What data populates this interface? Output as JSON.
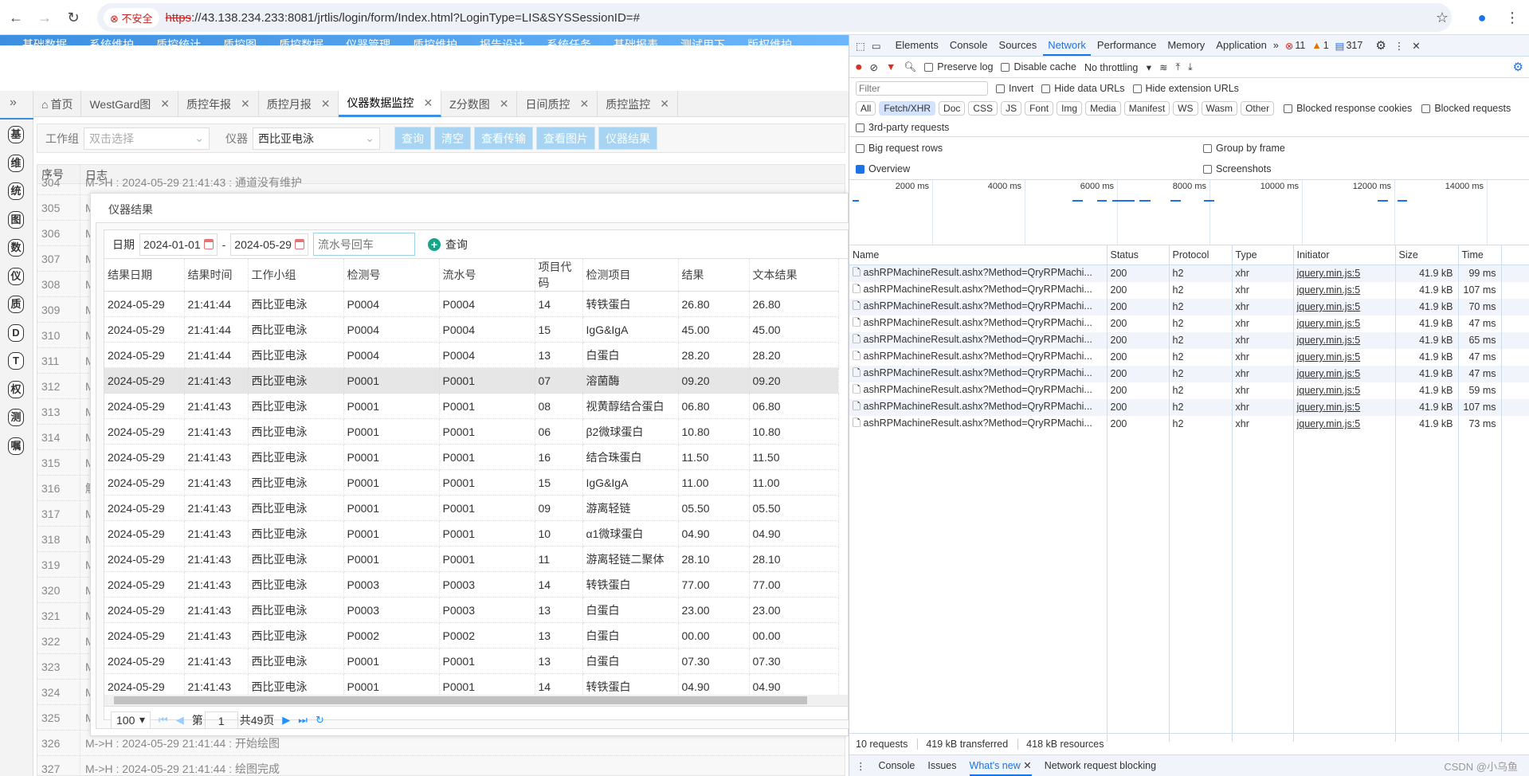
{
  "browser": {
    "url_scheme": "https",
    "url_rest": "://43.138.234.233:8081/jrtlis/login/form/Index.html?LoginType=LIS&SYSSessionID=#",
    "insecure_label": "不安全"
  },
  "topnav": [
    "基础数据",
    "系统维护",
    "质控统计",
    "质控图",
    "质控数据",
    "仪器管理",
    "质控维护",
    "报告设计",
    "系统任务",
    "基础报表",
    "测试用下",
    "版权维护"
  ],
  "sidebar": [
    "基",
    "维",
    "统",
    "图",
    "数",
    "仪",
    "质",
    "D",
    "T",
    "权",
    "测",
    "嘱"
  ],
  "tabs": [
    {
      "label": "首页",
      "icon": "home-icon"
    },
    {
      "label": "WestGard图"
    },
    {
      "label": "质控年报"
    },
    {
      "label": "质控月报"
    },
    {
      "label": "仪器数据监控",
      "active": true
    },
    {
      "label": "Z分数图"
    },
    {
      "label": "日间质控"
    },
    {
      "label": "质控监控"
    }
  ],
  "toolbar": {
    "workgroup_label": "工作组",
    "workgroup_value": "双击选择",
    "instrument_label": "仪器",
    "instrument_value": "西比亚电泳",
    "buttons": [
      "查询",
      "清空",
      "查看传输",
      "查看图片",
      "仪器结果"
    ]
  },
  "log": {
    "columns": [
      "序号",
      "日志"
    ],
    "rows": [
      [
        "304",
        "M->H : 2024-05-29 21:41:43 : 通道没有维护"
      ],
      [
        "305",
        "M"
      ],
      [
        "306",
        "M"
      ],
      [
        "307",
        "M"
      ],
      [
        "308",
        "M"
      ],
      [
        "309",
        "M"
      ],
      [
        "310",
        "M"
      ],
      [
        "311",
        "M"
      ],
      [
        "312",
        "M"
      ],
      [
        "313",
        "M"
      ],
      [
        "314",
        "M"
      ],
      [
        "315",
        "M"
      ],
      [
        "316",
        "解"
      ],
      [
        "317",
        "M"
      ],
      [
        "318",
        "M"
      ],
      [
        "319",
        "M"
      ],
      [
        "320",
        "M"
      ],
      [
        "321",
        "M"
      ],
      [
        "322",
        "M"
      ],
      [
        "323",
        "M"
      ],
      [
        "324",
        "M"
      ],
      [
        "325",
        "M"
      ],
      [
        "326",
        "M->H : 2024-05-29 21:41:44 : 开始绘图"
      ],
      [
        "327",
        "M->H : 2024-05-29 21:41:44 : 绘图完成"
      ]
    ]
  },
  "dialog": {
    "title": "仪器结果",
    "date_label": "日期",
    "date_from": "2024-01-01",
    "date_to": "2024-05-29",
    "serial_placeholder": "流水号回车",
    "query_label": "查询",
    "columns": [
      "结果日期",
      "结果时间",
      "工作小组",
      "检测号",
      "流水号",
      "项目代码",
      "检测项目",
      "结果",
      "文本结果"
    ],
    "rows": [
      [
        "2024-05-29",
        "21:41:44",
        "西比亚电泳",
        "P0004",
        "P0004",
        "14",
        "转铁蛋白",
        "26.80",
        "26.80"
      ],
      [
        "2024-05-29",
        "21:41:44",
        "西比亚电泳",
        "P0004",
        "P0004",
        "15",
        "IgG&IgA",
        "45.00",
        "45.00"
      ],
      [
        "2024-05-29",
        "21:41:44",
        "西比亚电泳",
        "P0004",
        "P0004",
        "13",
        "白蛋白",
        "28.20",
        "28.20"
      ],
      [
        "2024-05-29",
        "21:41:43",
        "西比亚电泳",
        "P0001",
        "P0001",
        "07",
        "溶菌酶",
        "09.20",
        "09.20"
      ],
      [
        "2024-05-29",
        "21:41:43",
        "西比亚电泳",
        "P0001",
        "P0001",
        "08",
        "视黄醇结合蛋白",
        "06.80",
        "06.80"
      ],
      [
        "2024-05-29",
        "21:41:43",
        "西比亚电泳",
        "P0001",
        "P0001",
        "06",
        "β2微球蛋白",
        "10.80",
        "10.80"
      ],
      [
        "2024-05-29",
        "21:41:43",
        "西比亚电泳",
        "P0001",
        "P0001",
        "16",
        "结合珠蛋白",
        "11.50",
        "11.50"
      ],
      [
        "2024-05-29",
        "21:41:43",
        "西比亚电泳",
        "P0001",
        "P0001",
        "15",
        "IgG&IgA",
        "11.00",
        "11.00"
      ],
      [
        "2024-05-29",
        "21:41:43",
        "西比亚电泳",
        "P0001",
        "P0001",
        "09",
        "游离轻链",
        "05.50",
        "05.50"
      ],
      [
        "2024-05-29",
        "21:41:43",
        "西比亚电泳",
        "P0001",
        "P0001",
        "10",
        "α1微球蛋白",
        "04.90",
        "04.90"
      ],
      [
        "2024-05-29",
        "21:41:43",
        "西比亚电泳",
        "P0001",
        "P0001",
        "11",
        "游离轻链二聚体",
        "28.10",
        "28.10"
      ],
      [
        "2024-05-29",
        "21:41:43",
        "西比亚电泳",
        "P0003",
        "P0003",
        "14",
        "转铁蛋白",
        "77.00",
        "77.00"
      ],
      [
        "2024-05-29",
        "21:41:43",
        "西比亚电泳",
        "P0003",
        "P0003",
        "13",
        "白蛋白",
        "23.00",
        "23.00"
      ],
      [
        "2024-05-29",
        "21:41:43",
        "西比亚电泳",
        "P0002",
        "P0002",
        "13",
        "白蛋白",
        "00.00",
        "00.00"
      ],
      [
        "2024-05-29",
        "21:41:43",
        "西比亚电泳",
        "P0001",
        "P0001",
        "13",
        "白蛋白",
        "07.30",
        "07.30"
      ],
      [
        "2024-05-29",
        "21:41:43",
        "西比亚电泳",
        "P0001",
        "P0001",
        "14",
        "转铁蛋白",
        "04.90",
        "04.90"
      ]
    ],
    "highlighted_row": 3,
    "pager": {
      "page_size": "100",
      "page_label": "第",
      "page": "1",
      "total_label": "共49页"
    }
  },
  "devtools": {
    "tabs": [
      "Elements",
      "Console",
      "Sources",
      "Network",
      "Performance",
      "Memory",
      "Application"
    ],
    "active_tab": "Network",
    "errors": "11",
    "warnings": "1",
    "messages": "317",
    "preserve_log": "Preserve log",
    "disable_cache": "Disable cache",
    "throttling": "No throttling",
    "filter_placeholder": "Filter",
    "invert": "Invert",
    "hide_data_urls": "Hide data URLs",
    "hide_ext_urls": "Hide extension URLs",
    "type_filters": [
      "All",
      "Fetch/XHR",
      "Doc",
      "CSS",
      "JS",
      "Font",
      "Img",
      "Media",
      "Manifest",
      "WS",
      "Wasm",
      "Other"
    ],
    "active_filter": "Fetch/XHR",
    "blocked_cookies": "Blocked response cookies",
    "blocked_requests": "Blocked requests",
    "third_party": "3rd-party requests",
    "big_rows": "Big request rows",
    "group_by_frame": "Group by frame",
    "overview": "Overview",
    "screenshots": "Screenshots",
    "timeline_ticks": [
      "2000 ms",
      "4000 ms",
      "6000 ms",
      "8000 ms",
      "10000 ms",
      "12000 ms",
      "14000 ms"
    ],
    "columns": [
      "Name",
      "Status",
      "Protocol",
      "Type",
      "Initiator",
      "Size",
      "Time"
    ],
    "requests": [
      [
        "ashRPMachineResult.ashx?Method=QryRPMachi...",
        "200",
        "h2",
        "xhr",
        "jquery.min.js:5",
        "41.9 kB",
        "99 ms"
      ],
      [
        "ashRPMachineResult.ashx?Method=QryRPMachi...",
        "200",
        "h2",
        "xhr",
        "jquery.min.js:5",
        "41.9 kB",
        "107 ms"
      ],
      [
        "ashRPMachineResult.ashx?Method=QryRPMachi...",
        "200",
        "h2",
        "xhr",
        "jquery.min.js:5",
        "41.9 kB",
        "70 ms"
      ],
      [
        "ashRPMachineResult.ashx?Method=QryRPMachi...",
        "200",
        "h2",
        "xhr",
        "jquery.min.js:5",
        "41.9 kB",
        "47 ms"
      ],
      [
        "ashRPMachineResult.ashx?Method=QryRPMachi...",
        "200",
        "h2",
        "xhr",
        "jquery.min.js:5",
        "41.9 kB",
        "65 ms"
      ],
      [
        "ashRPMachineResult.ashx?Method=QryRPMachi...",
        "200",
        "h2",
        "xhr",
        "jquery.min.js:5",
        "41.9 kB",
        "47 ms"
      ],
      [
        "ashRPMachineResult.ashx?Method=QryRPMachi...",
        "200",
        "h2",
        "xhr",
        "jquery.min.js:5",
        "41.9 kB",
        "47 ms"
      ],
      [
        "ashRPMachineResult.ashx?Method=QryRPMachi...",
        "200",
        "h2",
        "xhr",
        "jquery.min.js:5",
        "41.9 kB",
        "59 ms"
      ],
      [
        "ashRPMachineResult.ashx?Method=QryRPMachi...",
        "200",
        "h2",
        "xhr",
        "jquery.min.js:5",
        "41.9 kB",
        "107 ms"
      ],
      [
        "ashRPMachineResult.ashx?Method=QryRPMachi...",
        "200",
        "h2",
        "xhr",
        "jquery.min.js:5",
        "41.9 kB",
        "73 ms"
      ]
    ],
    "summary": [
      "10 requests",
      "419 kB transferred",
      "418 kB resources"
    ],
    "drawer_tabs": [
      "Console",
      "Issues",
      "What's new",
      "Network request blocking"
    ],
    "active_drawer": "What's new"
  },
  "watermark": "CSDN @小乌鱼"
}
